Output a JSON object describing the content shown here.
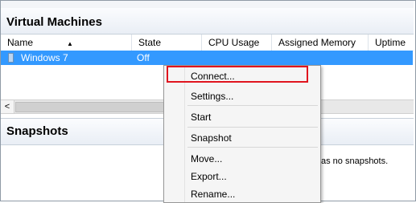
{
  "vm_section": {
    "title": "Virtual Machines",
    "columns": [
      "Name",
      "State",
      "CPU Usage",
      "Assigned Memory",
      "Uptime"
    ],
    "rows": [
      {
        "name": "Windows 7",
        "state": "Off"
      }
    ]
  },
  "scrollbar": {
    "left_arrow": "<"
  },
  "snapshots_section": {
    "title": "Snapshots",
    "message_partial": "as no snapshots."
  },
  "context_menu": {
    "items": [
      "Connect...",
      "Settings...",
      "Start",
      "Snapshot",
      "Move...",
      "Export...",
      "Rename..."
    ],
    "highlighted": "Connect..."
  },
  "colors": {
    "selection": "#3399ff",
    "highlight_border": "#e0141e"
  }
}
